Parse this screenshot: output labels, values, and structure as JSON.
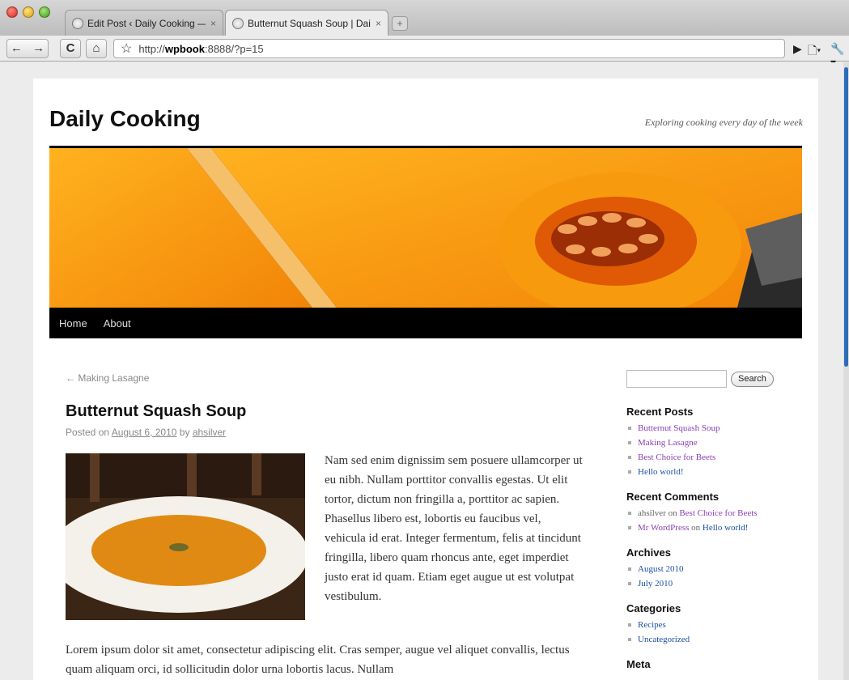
{
  "browser": {
    "tabs": [
      {
        "title": "Edit Post ‹ Daily Cooking — V",
        "close": "×"
      },
      {
        "title": "Butternut Squash Soup | Dail",
        "close": "×"
      }
    ],
    "new_tab": "+",
    "url_prefix": "http://",
    "url_host": "wpbook",
    "url_rest": ":8888/?p=15",
    "buttons": {
      "back": "←",
      "forward": "→",
      "reload": "C",
      "home": "⌂",
      "bookmark": "☆",
      "go": "▶",
      "page_menu": "🗋▾",
      "tools_menu": "🔧▾"
    }
  },
  "site": {
    "title": "Daily Cooking",
    "tagline": "Exploring cooking every day of the week",
    "nav": [
      "Home",
      "About"
    ]
  },
  "post": {
    "prev_link": "← Making Lasagne",
    "title": "Butternut Squash Soup",
    "posted_on": "Posted on",
    "date": "August 6, 2010",
    "by": "by",
    "author": "ahsilver",
    "para1": "Nam sed enim dignissim sem posuere ullamcorper ut eu nibh. Nullam porttitor convallis egestas. Ut elit tortor, dictum non fringilla a, porttitor ac sapien. Phasellus libero est, lobortis eu faucibus vel, vehicula id erat. Integer fermentum, felis at tincidunt fringilla, libero quam rhoncus ante, eget imperdiet justo erat id quam. Etiam eget augue ut est volutpat vestibulum.",
    "para2": "Lorem ipsum dolor sit amet, consectetur adipiscing elit. Cras semper, augue vel aliquet convallis, lectus quam aliquam orci, id sollicitudin dolor urna lobortis lacus. Nullam"
  },
  "sidebar": {
    "search_button": "Search",
    "recent_posts_title": "Recent Posts",
    "recent_posts": [
      "Butternut Squash Soup",
      "Making Lasagne",
      "Best Choice for Beets",
      "Hello world!"
    ],
    "recent_comments_title": "Recent Comments",
    "recent_comments": [
      {
        "author": "ahsilver",
        "on": "on",
        "post": "Best Choice for Beets"
      },
      {
        "author": "Mr WordPress",
        "on": "on",
        "post": "Hello world!"
      }
    ],
    "archives_title": "Archives",
    "archives": [
      "August 2010",
      "July 2010"
    ],
    "categories_title": "Categories",
    "categories": [
      "Recipes",
      "Uncategorized"
    ],
    "meta_title": "Meta"
  },
  "colors": {
    "nav_bg": "#000000",
    "link_purple": "#8a3fb8",
    "link_blue": "#1b4fa3"
  }
}
